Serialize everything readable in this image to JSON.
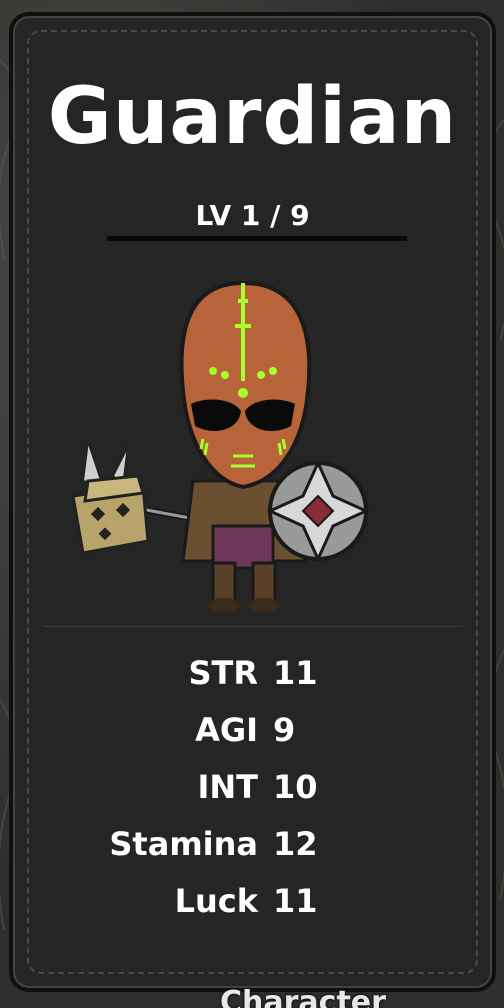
{
  "card": {
    "title": "Guardian",
    "level_label": "LV 1 / 9"
  },
  "portrait": {
    "icon": "guardian-warrior-portrait",
    "mask_color": "#b8643a",
    "glow_color": "#a6ff2a"
  },
  "stats": [
    {
      "name": "STR",
      "value": "11"
    },
    {
      "name": "AGI",
      "value": "9"
    },
    {
      "name": "INT",
      "value": "10"
    },
    {
      "name": "Stamina",
      "value": "12"
    },
    {
      "name": "Luck",
      "value": "11"
    }
  ],
  "background": {
    "peek_text": "Character"
  }
}
